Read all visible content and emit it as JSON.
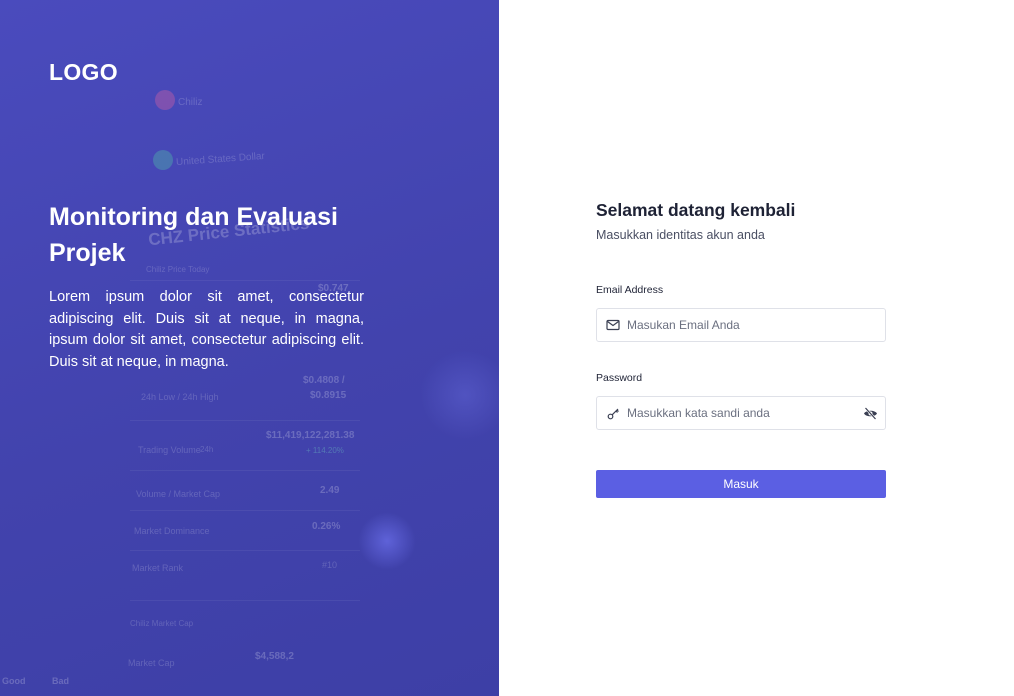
{
  "brand": {
    "logo": "LOGO"
  },
  "hero": {
    "title": "Monitoring dan Evaluasi Projek",
    "description": "Lorem ipsum dolor sit amet, consectetur adipiscing elit. Duis sit at neque, in magna, ipsum dolor sit amet, consectetur adipiscing elit. Duis sit at neque, in magna."
  },
  "background": {
    "texts": [
      "Chiliz",
      "United States Dollar",
      "CHZ Price Statistics",
      "Chiliz Price Today",
      "$0.747",
      "24h Low / 24h High",
      "$0.4808 /",
      "$0.8915",
      "Trading Volume",
      "24h",
      "$11,419,122,281.38",
      "+ 114.20%",
      "Volume / Market Cap",
      "2.49",
      "Market Dominance",
      "0.26%",
      "Market Rank",
      "#10",
      "Chiliz Market Cap",
      "Market Cap",
      "$4,588,2",
      "Good",
      "Bad"
    ]
  },
  "login": {
    "title": "Selamat datang kembali",
    "subtitle": "Masukkan identitas akun anda",
    "email": {
      "label": "Email Address",
      "placeholder": "Masukan Email Anda",
      "value": ""
    },
    "password": {
      "label": "Password",
      "placeholder": "Masukkan kata sandi anda",
      "value": ""
    },
    "submit_label": "Masuk"
  },
  "colors": {
    "panel": "#4243ad",
    "accent": "#5b5fe3",
    "heading": "#1e2235",
    "border": "#dfe1e8"
  },
  "icons": {
    "email": "mail-icon",
    "password": "key-icon",
    "toggle": "eye-off-icon"
  }
}
